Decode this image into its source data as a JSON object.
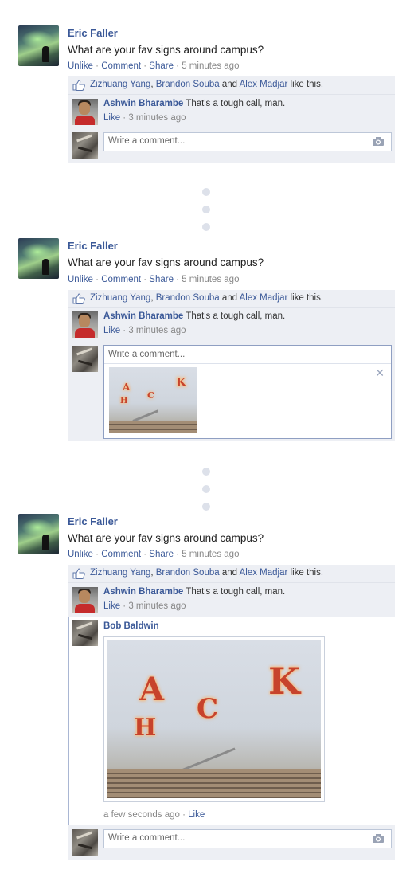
{
  "post": {
    "author": "Eric Faller",
    "message": "What are your fav signs around campus?",
    "actions": {
      "unlike": "Unlike",
      "comment": "Comment",
      "share": "Share",
      "sep": " · ",
      "time": "5 minutes ago"
    },
    "likes": {
      "person1": "Zizhuang Yang",
      "sep1": ", ",
      "person2": "Brandon Souba",
      "and": " and ",
      "person3": "Alex Madjar",
      "suffix": " like this."
    },
    "comment1": {
      "author": "Ashwin Bharambe",
      "text": " That's a tough call, man.",
      "like": "Like",
      "time": " · 3 minutes ago"
    },
    "input_placeholder": "Write a comment...",
    "bob": {
      "author": "Bob Baldwin",
      "time": "a few seconds ago · ",
      "like": "Like"
    }
  },
  "sign_letters": [
    "A",
    "H",
    "C",
    "K"
  ],
  "colors": {
    "link": "#3b5998",
    "ufi_bg": "#edeff4",
    "dot": "#dde1ea"
  },
  "icons": [
    "thumbs-up-icon",
    "camera-icon",
    "close-icon"
  ]
}
